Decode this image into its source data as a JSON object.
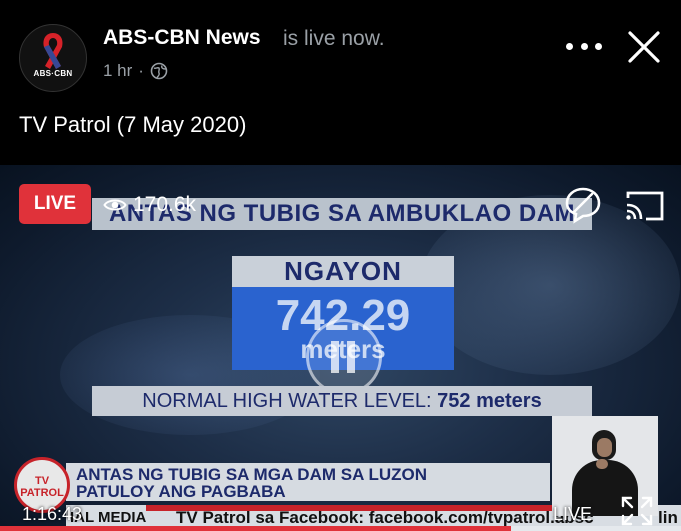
{
  "post": {
    "page_name": "ABS-CBN News",
    "status": "is live now.",
    "time_ago": "1 hr",
    "privacy_icon": "globe-icon",
    "video_title": "TV Patrol (7 May 2020)",
    "avatar_text": "ABS·CBN"
  },
  "player": {
    "live_badge": "LIVE",
    "viewer_count": "170.6k",
    "timecode": "1:16:43",
    "live_label": "LIVE",
    "progress": 0.75
  },
  "broadcast": {
    "top_banner": "ANTAS NG TUBIG SA AMBUKLAO DAM",
    "now_label": "NGAYON",
    "level_value": "742.29",
    "level_unit": "meters",
    "high_water_label": "NORMAL HIGH WATER LEVEL:",
    "high_water_value": "752 meters",
    "headline_line1": "ANTAS NG TUBIG SA MGA DAM SA LUZON",
    "headline_line2": "PATULOY ANG PAGBABA",
    "ticker_source": "IAL MEDIA",
    "ticker_text": "TV Patrol sa Facebook: facebook.com/tvpatrol.absc",
    "ticker_tail": "lin",
    "logo_text": "TV PATROL"
  },
  "colors": {
    "live_red": "#e0323a",
    "banner_navy": "#1d2a6b",
    "value_blue": "#2a63cf"
  }
}
